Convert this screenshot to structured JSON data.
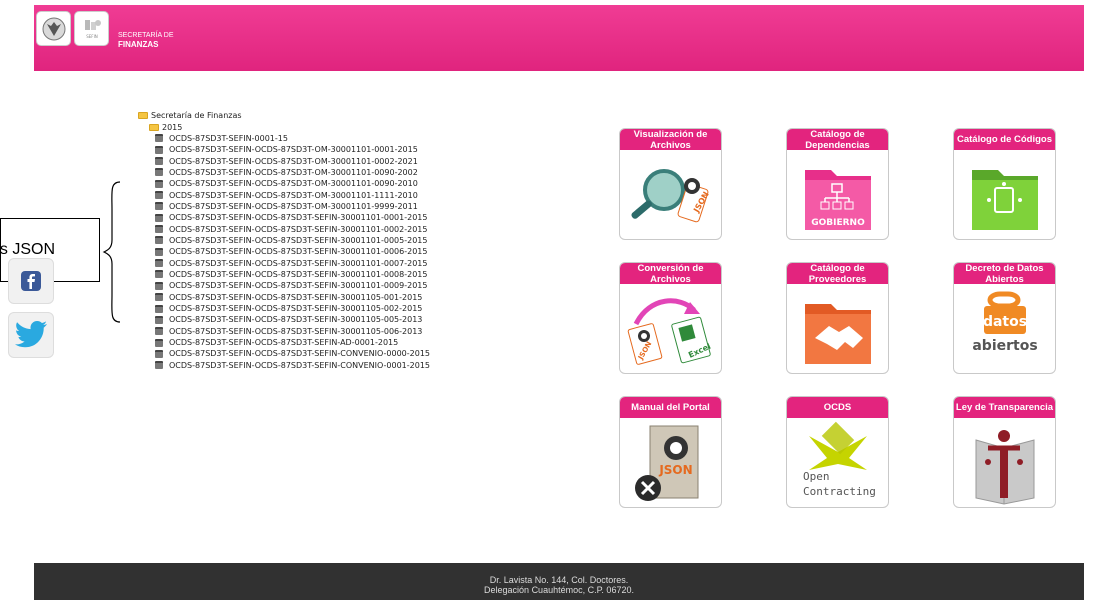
{
  "header": {
    "brand_line1": "SECRETARÍA DE",
    "brand_line2": "FINANZAS",
    "logo1_icon": "shield-emblem-icon",
    "logo2_icon": "sefin-logo-icon",
    "logo2_text": "SEFIN",
    "color": "#e6287f"
  },
  "callout": {
    "text": "os JSON"
  },
  "social": [
    {
      "icon": "facebook-icon"
    },
    {
      "icon": "twitter-icon"
    }
  ],
  "tree": {
    "root": "Secretaría de Finanzas",
    "year": "2015",
    "files": [
      "OCDS-87SD3T-SEFIN-0001-15",
      "OCDS-87SD3T-SEFIN-OCDS-87SD3T-OM-30001101-0001-2015",
      "OCDS-87SD3T-SEFIN-OCDS-87SD3T-OM-30001101-0002-2021",
      "OCDS-87SD3T-SEFIN-OCDS-87SD3T-OM-30001101-0090-2002",
      "OCDS-87SD3T-SEFIN-OCDS-87SD3T-OM-30001101-0090-2010",
      "OCDS-87SD3T-SEFIN-OCDS-87SD3T-OM-30001101-1111-2010",
      "OCDS-87SD3T-SEFIN-OCDS-87SD3T-OM-30001101-9999-2011",
      "OCDS-87SD3T-SEFIN-OCDS-87SD3T-SEFIN-30001101-0001-2015",
      "OCDS-87SD3T-SEFIN-OCDS-87SD3T-SEFIN-30001101-0002-2015",
      "OCDS-87SD3T-SEFIN-OCDS-87SD3T-SEFIN-30001101-0005-2015",
      "OCDS-87SD3T-SEFIN-OCDS-87SD3T-SEFIN-30001101-0006-2015",
      "OCDS-87SD3T-SEFIN-OCDS-87SD3T-SEFIN-30001101-0007-2015",
      "OCDS-87SD3T-SEFIN-OCDS-87SD3T-SEFIN-30001101-0008-2015",
      "OCDS-87SD3T-SEFIN-OCDS-87SD3T-SEFIN-30001101-0009-2015",
      "OCDS-87SD3T-SEFIN-OCDS-87SD3T-SEFIN-30001105-001-2015",
      "OCDS-87SD3T-SEFIN-OCDS-87SD3T-SEFIN-30001105-002-2015",
      "OCDS-87SD3T-SEFIN-OCDS-87SD3T-SEFIN-30001105-005-2013",
      "OCDS-87SD3T-SEFIN-OCDS-87SD3T-SEFIN-30001105-006-2013",
      "OCDS-87SD3T-SEFIN-OCDS-87SD3T-SEFIN-AD-0001-2015",
      "OCDS-87SD3T-SEFIN-OCDS-87SD3T-SEFIN-CONVENIO-0000-2015",
      "OCDS-87SD3T-SEFIN-OCDS-87SD3T-SEFIN-CONVENIO-0001-2015"
    ]
  },
  "tiles": [
    {
      "title": "Visualización de Archivos",
      "icon": "magnifier-json-icon",
      "img_text": "JSON"
    },
    {
      "title": "Catálogo de Dependencias",
      "icon": "folder-org-chart-icon",
      "img_text": "GOBIERNO"
    },
    {
      "title": "Catálogo de Códigos",
      "icon": "folder-code-icon",
      "img_text": ""
    },
    {
      "title": "Conversión de Archivos",
      "icon": "json-to-excel-icon",
      "img_text": "JSON",
      "img_text2": "Excel"
    },
    {
      "title": "Catálogo de Proveedores",
      "icon": "folder-handshake-icon",
      "img_text": ""
    },
    {
      "title": "Decreto de Datos Abiertos",
      "icon": "datos-abiertos-lock-icon",
      "img_text": "datos",
      "img_text2": "abiertos"
    },
    {
      "title": "Manual del Portal",
      "icon": "json-manual-icon",
      "img_text": "JSON"
    },
    {
      "title": "OCDS",
      "icon": "open-contracting-icon",
      "img_text": "Open",
      "img_text2": "Contracting"
    },
    {
      "title": "Ley de Transparencia",
      "icon": "transparency-book-icon",
      "img_text": ""
    }
  ],
  "footer": {
    "line1": "Dr. Lavista No. 144, Col. Doctores.",
    "line2": "Delegación Cuauhtémoc, C.P. 06720."
  }
}
